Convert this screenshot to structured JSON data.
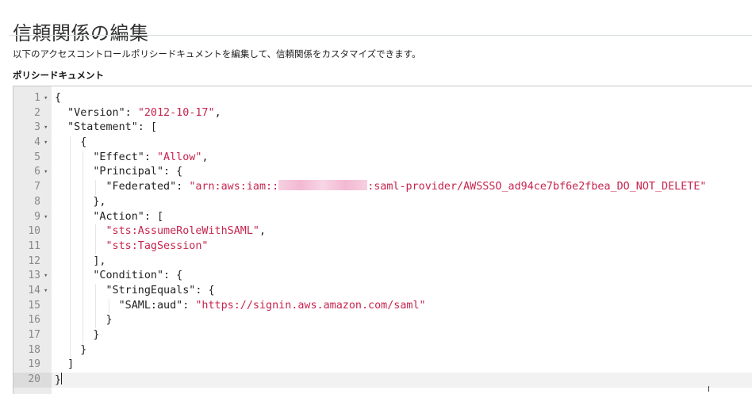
{
  "title": "信頼関係の編集",
  "description": "以下のアクセスコントロールポリシードキュメントを編集して、信頼関係をカスタマイズできます。",
  "policy_label": "ポリシードキュメント",
  "colors": {
    "string": "#c7254e",
    "gutter": "#ebebeb",
    "text": "#222222"
  },
  "editor": {
    "lines": [
      {
        "n": "1",
        "fold": true,
        "tokens": [
          {
            "t": "p",
            "v": "{"
          }
        ]
      },
      {
        "n": "2",
        "fold": false,
        "tokens": [
          {
            "t": "p",
            "v": "  \"Version\": "
          },
          {
            "t": "s",
            "v": "\"2012-10-17\""
          },
          {
            "t": "p",
            "v": ","
          }
        ]
      },
      {
        "n": "3",
        "fold": true,
        "tokens": [
          {
            "t": "p",
            "v": "  \"Statement\": ["
          }
        ]
      },
      {
        "n": "4",
        "fold": true,
        "tokens": [
          {
            "t": "p",
            "v": "    {"
          }
        ]
      },
      {
        "n": "5",
        "fold": false,
        "tokens": [
          {
            "t": "p",
            "v": "      \"Effect\": "
          },
          {
            "t": "s",
            "v": "\"Allow\""
          },
          {
            "t": "p",
            "v": ","
          }
        ]
      },
      {
        "n": "6",
        "fold": true,
        "tokens": [
          {
            "t": "p",
            "v": "      \"Principal\": {"
          }
        ]
      },
      {
        "n": "7",
        "fold": false,
        "tokens": [
          {
            "t": "p",
            "v": "        \"Federated\": "
          },
          {
            "t": "s",
            "v": "\"arn:aws:iam::"
          },
          {
            "t": "r",
            "v": ""
          },
          {
            "t": "s",
            "v": ":saml-provider/AWSSSO_ad94ce7bf6e2fbea_DO_NOT_DELETE\""
          }
        ]
      },
      {
        "n": "8",
        "fold": false,
        "tokens": [
          {
            "t": "p",
            "v": "      },"
          }
        ]
      },
      {
        "n": "9",
        "fold": true,
        "tokens": [
          {
            "t": "p",
            "v": "      \"Action\": ["
          }
        ]
      },
      {
        "n": "10",
        "fold": false,
        "tokens": [
          {
            "t": "p",
            "v": "        "
          },
          {
            "t": "s",
            "v": "\"sts:AssumeRoleWithSAML\""
          },
          {
            "t": "p",
            "v": ","
          }
        ]
      },
      {
        "n": "11",
        "fold": false,
        "tokens": [
          {
            "t": "p",
            "v": "        "
          },
          {
            "t": "s",
            "v": "\"sts:TagSession\""
          }
        ]
      },
      {
        "n": "12",
        "fold": false,
        "tokens": [
          {
            "t": "p",
            "v": "      ],"
          }
        ]
      },
      {
        "n": "13",
        "fold": true,
        "tokens": [
          {
            "t": "p",
            "v": "      \"Condition\": {"
          }
        ]
      },
      {
        "n": "14",
        "fold": true,
        "tokens": [
          {
            "t": "p",
            "v": "        \"StringEquals\": {"
          }
        ]
      },
      {
        "n": "15",
        "fold": false,
        "tokens": [
          {
            "t": "p",
            "v": "          \"SAML:aud\": "
          },
          {
            "t": "s",
            "v": "\"https://signin.aws.amazon.com/saml\""
          }
        ]
      },
      {
        "n": "16",
        "fold": false,
        "tokens": [
          {
            "t": "p",
            "v": "        }"
          }
        ]
      },
      {
        "n": "17",
        "fold": false,
        "tokens": [
          {
            "t": "p",
            "v": "      }"
          }
        ]
      },
      {
        "n": "18",
        "fold": false,
        "tokens": [
          {
            "t": "p",
            "v": "    }"
          }
        ]
      },
      {
        "n": "19",
        "fold": false,
        "tokens": [
          {
            "t": "p",
            "v": "  ]"
          }
        ]
      },
      {
        "n": "20",
        "fold": false,
        "active": true,
        "tokens": [
          {
            "t": "p",
            "v": "}"
          }
        ]
      }
    ]
  }
}
